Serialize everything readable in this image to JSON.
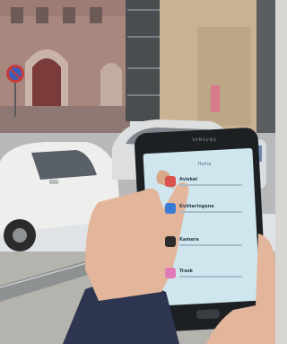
{
  "phone": {
    "brand_label": "SAMSUNG",
    "screen": {
      "header": "Home",
      "items": [
        {
          "label": "Aviskel",
          "icon_color": "#d9534f"
        },
        {
          "label": "Kvitteringene",
          "icon_color": "#3a7bd5"
        },
        {
          "label": "Kamera",
          "icon_color": "#2b2b2b"
        },
        {
          "label": "Trask",
          "icon_color": "#e07bb8"
        }
      ]
    }
  },
  "colors": {
    "sky": "#dfe3e6",
    "building_brick": "#a8877f",
    "building_tan": "#c8b293",
    "car_white": "#eeeeec",
    "phone_body": "#1d2023",
    "screen_bg": "#cfe6ef",
    "sleeve": "#2d3550",
    "skin": "#e3b69b"
  }
}
